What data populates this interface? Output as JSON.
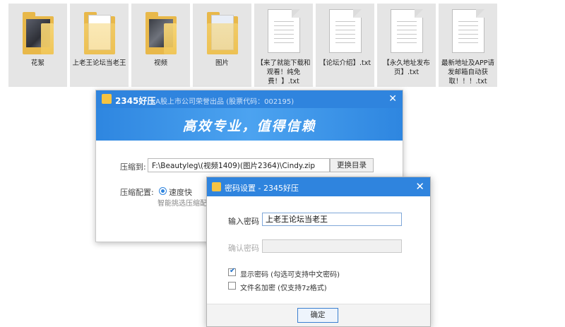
{
  "desktop": {
    "files": [
      {
        "label": "花絮",
        "icon": "folder-icon"
      },
      {
        "label": "上老王论坛当老王",
        "icon": "folder-icon"
      },
      {
        "label": "视频",
        "icon": "folder-icon"
      },
      {
        "label": "图片",
        "icon": "folder-icon"
      },
      {
        "label": "【来了就能下载和观看！纯免费！】.txt",
        "icon": "text-file-icon"
      },
      {
        "label": "【论坛介绍】.txt",
        "icon": "text-file-icon"
      },
      {
        "label": "【永久地址发布页】.txt",
        "icon": "text-file-icon"
      },
      {
        "label": "最新地址及APP请发邮箱自动获取！！！.txt",
        "icon": "text-file-icon"
      }
    ]
  },
  "compress_dialog": {
    "title": "2345好压",
    "subtitle": "– A股上市公司荣誉出品 (股票代码：002195)",
    "close": "✕",
    "slogan": "高效专业，值得信赖",
    "path_label": "压缩到:",
    "path_value": "F:\\Beautyleg\\(视频1409)(图片2364)\\Cindy.zip",
    "browse_button": "更换目录",
    "config_label": "压缩配置:",
    "speed_option": "速度快",
    "hint": "智能挑选压缩配置"
  },
  "password_dialog": {
    "title": "密码设置 - 2345好压",
    "close": "✕",
    "password_label": "输入密码",
    "password_value": "上老王论坛当老王",
    "confirm_label": "确认密码",
    "confirm_value": "",
    "show_password_label": "显示密码 (勾选可支持中文密码)",
    "show_password_checked": true,
    "encrypt_names_label": "文件名加密 (仅支持7z格式)",
    "encrypt_names_checked": false,
    "ok_button": "确定"
  },
  "colors": {
    "accent": "#2f84de",
    "folder": "#f0c75a",
    "tile_bg": "#e5e5e5"
  }
}
